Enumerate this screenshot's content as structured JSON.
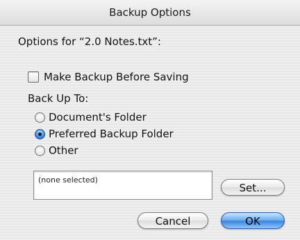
{
  "window": {
    "title": "Backup Options"
  },
  "options_label": "Options for “2.0 Notes.txt”:",
  "make_backup": {
    "label": "Make Backup Before Saving",
    "checked": false
  },
  "back_up_to": {
    "label": "Back Up To:",
    "options": [
      {
        "label": "Document's Folder",
        "selected": false
      },
      {
        "label": "Preferred Backup Folder",
        "selected": true
      },
      {
        "label": "Other",
        "selected": false
      }
    ]
  },
  "path_field": {
    "value": "(none selected)"
  },
  "buttons": {
    "set": "Set...",
    "cancel": "Cancel",
    "ok": "OK"
  },
  "colors": {
    "accent": "#3d86dd"
  }
}
